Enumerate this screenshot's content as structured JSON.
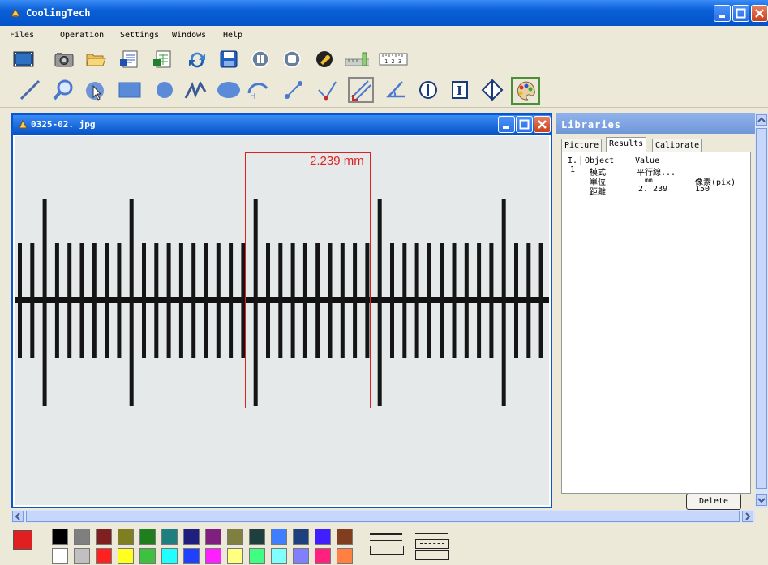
{
  "app": {
    "title": "CoolingTech"
  },
  "menu": [
    "Files",
    "Operation",
    "Settings",
    "Windows",
    "Help"
  ],
  "toolbar_top": {
    "icons": [
      "video-icon",
      "camera-icon",
      "folder-open-icon",
      "word-doc-icon",
      "excel-doc-icon",
      "refresh-icon",
      "save-icon",
      "pause-icon",
      "stop-icon",
      "settings-wrench-icon",
      "ruler-green-icon",
      "ruler-123-icon"
    ],
    "ruler_label": "1 2 3"
  },
  "toolbar_draw": {
    "icons": [
      "line-icon",
      "zoom-icon",
      "select-icon",
      "rectangle-icon",
      "circle-icon",
      "polyline-icon",
      "ellipse-icon",
      "arc-icon",
      "distance-icon",
      "angle-line-icon",
      "parallel-line-icon",
      "angle-icon",
      "center-circle-icon",
      "text-icon",
      "point-icon",
      "color-palette-icon"
    ],
    "arc_label": "H",
    "text_tool_label": "I"
  },
  "image_window": {
    "title": "0325-02. jpg",
    "measurement_label": "2.239 mm"
  },
  "libraries": {
    "title": "Libraries",
    "tabs": [
      "Picture",
      "Results",
      "Calibrate"
    ],
    "active_tab": "Results",
    "columns": [
      "I.",
      "Object",
      "Value"
    ],
    "rows": [
      {
        "index": "1",
        "object": "模式",
        "value": "平行線...",
        "extra": ""
      },
      {
        "index": "",
        "object": "單位",
        "value": "mm",
        "extra": "像素(pix)"
      },
      {
        "index": "",
        "object": "距離",
        "value": "2. 239",
        "extra": "150"
      }
    ],
    "delete_label": "Delete"
  },
  "colors": {
    "title_blue": "#0553c8",
    "measure_red": "#e02020",
    "current_color": "#e02020",
    "swatches_top": [
      "#000000",
      "#7f7f7f",
      "#7f1f1f",
      "#7f7f1f",
      "#1f7f1f",
      "#1f7f7f",
      "#1f1f7f",
      "#7f1f7f",
      "#7f7f3f",
      "#1f3f3f",
      "#3f7fff",
      "#1f3f7f",
      "#3f1fff",
      "#7f3f1f"
    ],
    "swatches_bottom": [
      "#ffffff",
      "#c0c0c0",
      "#ff2020",
      "#ffff20",
      "#40c040",
      "#20ffff",
      "#2040ff",
      "#ff20ff",
      "#ffff80",
      "#40ff80",
      "#80ffff",
      "#8080ff",
      "#ff2080",
      "#ff8040"
    ]
  }
}
